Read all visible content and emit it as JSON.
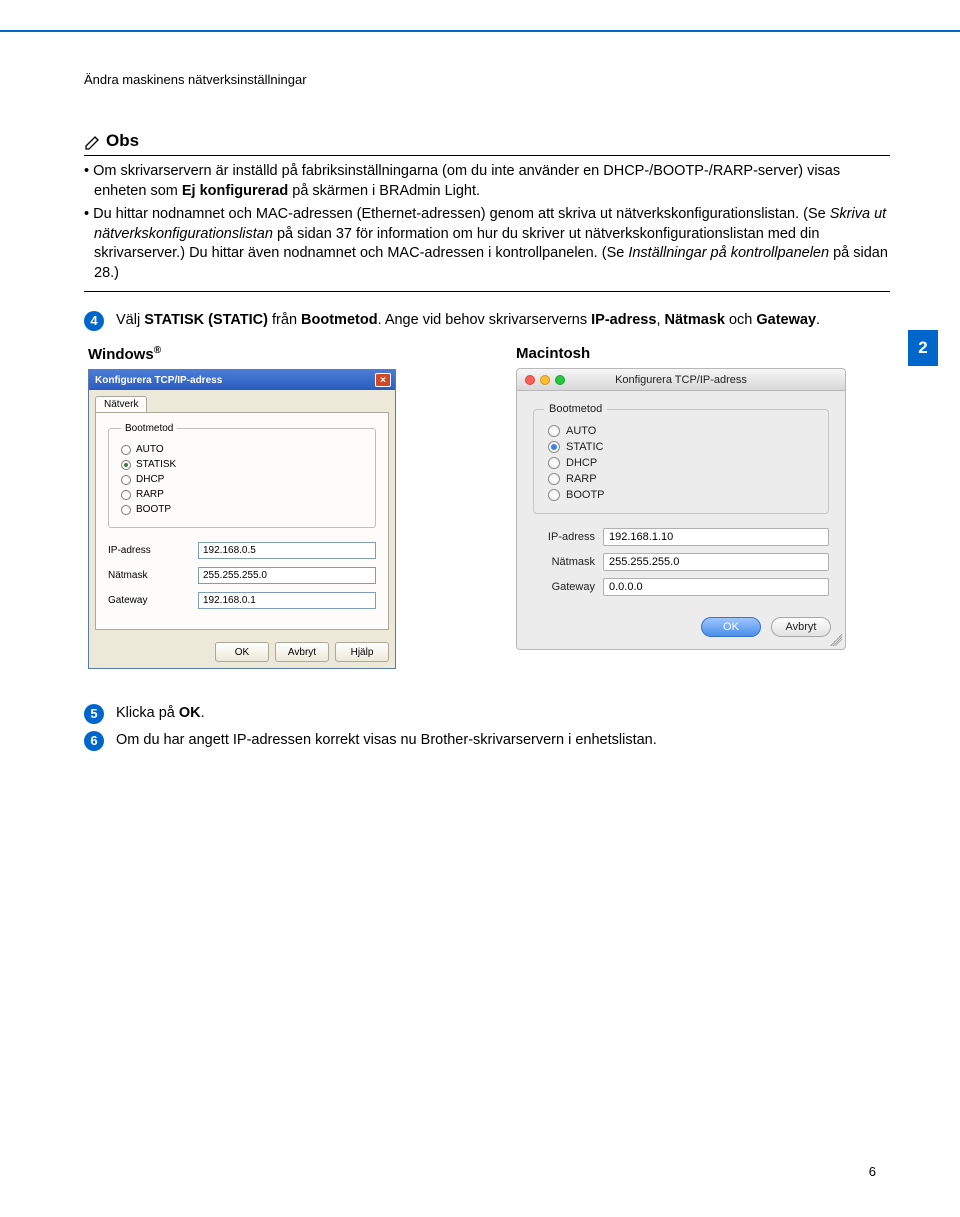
{
  "header": {
    "section_title": "Ändra maskinens nätverksinställningar"
  },
  "note": {
    "label": "Obs",
    "bullets": [
      {
        "pre": "Om skrivarservern är inställd på fabriksinställningarna (om du inte använder en DHCP-/BOOTP-/RARP-server) visas enheten som ",
        "bold": "Ej konfigurerad",
        "post": " på skärmen i BRAdmin Light."
      },
      {
        "pre": "Du hittar nodnamnet och MAC-adressen (Ethernet-adressen) genom att skriva ut nätverkskonfigurationslistan. (Se ",
        "it1": "Skriva ut nätverkskonfigurationslistan",
        "mid1": " på sidan 37 för information om hur du skriver ut nätverkskonfigurationslistan med din skrivarserver.) Du hittar även nodnamnet och MAC-adressen i kontrollpanelen. (Se ",
        "it2": "Inställningar på kontrollpanelen",
        "mid2": " på sidan 28.)"
      }
    ]
  },
  "side_tab": "2",
  "steps": {
    "s4": {
      "num": "4",
      "pre": "Välj ",
      "b1": "STATISK (STATIC)",
      "mid1": " från ",
      "b2": "Bootmetod",
      "mid2": ". Ange vid behov skrivarserverns ",
      "b3": "IP-adress",
      "mid3": ", ",
      "b4": "Nätmask",
      "mid4": " och ",
      "b5": "Gateway",
      "post": "."
    },
    "s5": {
      "num": "5",
      "pre": "Klicka på ",
      "b1": "OK",
      "post": "."
    },
    "s6": {
      "num": "6",
      "text": "Om du har angett IP-adressen korrekt visas nu Brother-skrivarservern i enhetslistan."
    }
  },
  "os": {
    "windows": {
      "heading": "Windows",
      "dialog_title": "Konfigurera TCP/IP-adress",
      "tab": "Nätverk",
      "fieldset_label": "Bootmetod",
      "radios": [
        "AUTO",
        "STATISK",
        "DHCP",
        "RARP",
        "BOOTP"
      ],
      "selected": "STATISK",
      "rows": {
        "ip": {
          "label": "IP-adress",
          "value": "192.168.0.5"
        },
        "mask": {
          "label": "Nätmask",
          "value": "255.255.255.0"
        },
        "gw": {
          "label": "Gateway",
          "value": "192.168.0.1"
        }
      },
      "buttons": {
        "ok": "OK",
        "cancel": "Avbryt",
        "help": "Hjälp"
      }
    },
    "mac": {
      "heading": "Macintosh",
      "dialog_title": "Konfigurera TCP/IP-adress",
      "fieldset_label": "Bootmetod",
      "radios": [
        "AUTO",
        "STATIC",
        "DHCP",
        "RARP",
        "BOOTP"
      ],
      "selected": "STATIC",
      "rows": {
        "ip": {
          "label": "IP-adress",
          "value": "192.168.1.10"
        },
        "mask": {
          "label": "Nätmask",
          "value": "255.255.255.0"
        },
        "gw": {
          "label": "Gateway",
          "value": "0.0.0.0"
        }
      },
      "buttons": {
        "ok": "OK",
        "cancel": "Avbryt"
      }
    }
  },
  "page_number": "6"
}
